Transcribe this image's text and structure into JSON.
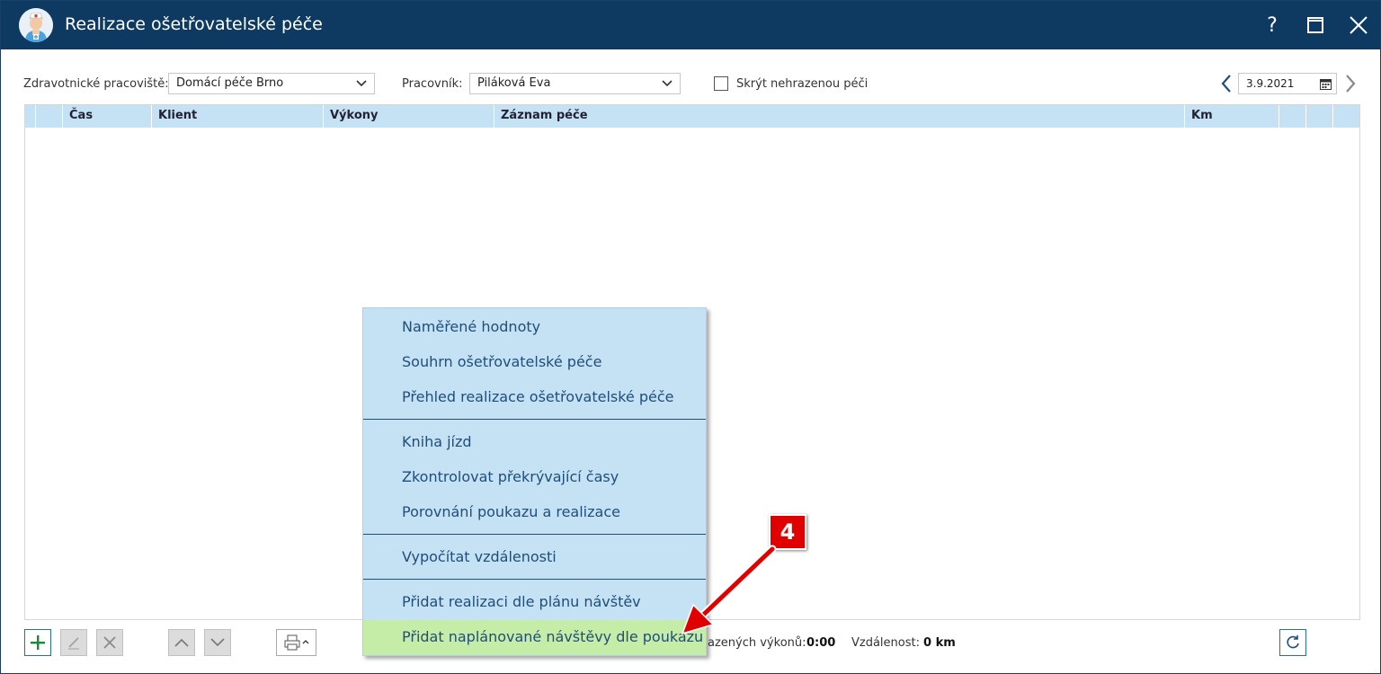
{
  "window": {
    "title": "Realizace ošetřovatelské péče",
    "help_label": "?"
  },
  "filters": {
    "workplace_label": "Zdravotnické pracoviště:",
    "workplace_value": "Domácí péče Brno",
    "worker_label": "Pracovník:",
    "worker_value": "Piláková Eva",
    "hide_label": "Skrýt nehrazenou péči",
    "hide_checked": false,
    "date_value": "3.9.2021"
  },
  "grid": {
    "columns": [
      "",
      "Čas",
      "Klient",
      "Výkony",
      "Záznam péče",
      "Km",
      "",
      ""
    ]
  },
  "context_menu": {
    "groups": [
      [
        "Naměřené hodnoty",
        "Souhrn ošetřovatelské péče",
        "Přehled realizace ošetřovatelské péče"
      ],
      [
        "Kniha jízd",
        "Zkontrolovat překrývající časy",
        "Porovnání poukazu a realizace"
      ],
      [
        "Vypočítat vzdálenosti"
      ],
      [
        "Přidat realizaci dle plánu návštěv",
        "Přidat naplánované návštěvy dle poukazu"
      ]
    ],
    "highlighted_item": "Přidat naplánované návštěvy dle poukazu"
  },
  "status": {
    "services_label": "azených výkonů:",
    "services_value": "0:00",
    "distance_label": "Vzdálenost:",
    "distance_value": "0 km"
  },
  "annotation": {
    "step_number": "4"
  },
  "colors": {
    "titlebar": "#0e3a62",
    "grid_header": "#c5e2f5",
    "menu_bg": "#c5e2f5",
    "menu_highlight": "#c6eda8",
    "menu_text": "#1f4e79",
    "callout": "#e00000"
  },
  "icons": {
    "app": "nurse-avatar-icon",
    "help": "help-icon",
    "maximize": "maximize-icon",
    "close": "close-icon",
    "add": "plus-icon",
    "edit": "pencil-icon",
    "delete": "x-icon",
    "up": "chevron-up-icon",
    "down": "chevron-down-icon",
    "print": "printer-icon",
    "refresh": "refresh-icon",
    "calendar": "calendar-icon"
  }
}
